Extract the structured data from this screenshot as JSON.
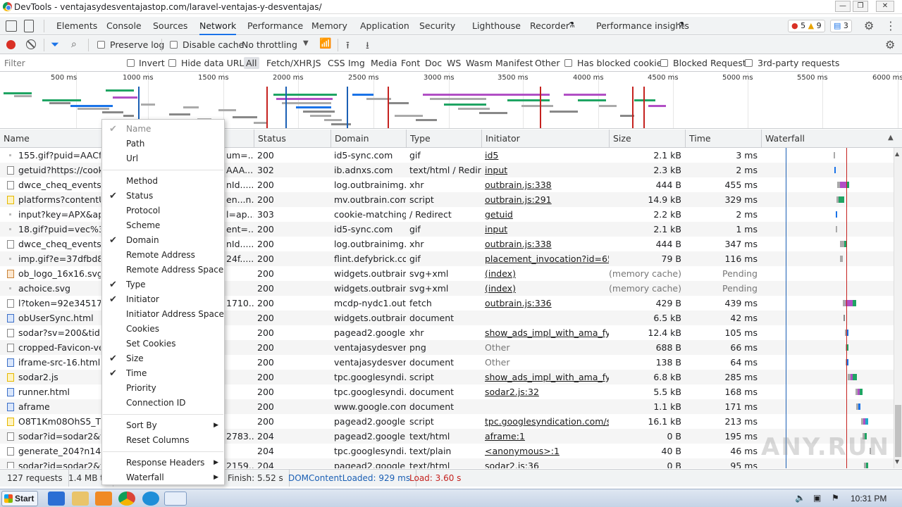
{
  "window": {
    "title": "DevTools - ventajasydesventajastop.com/laravel-ventajas-y-desventajas/",
    "minimize": "—",
    "restore": "❐",
    "close": "✕"
  },
  "tabs": [
    "Elements",
    "Console",
    "Sources",
    "Network",
    "Performance",
    "Memory",
    "Application",
    "Security",
    "Lighthouse",
    "Recorder",
    "Performance insights"
  ],
  "active_tab": "Network",
  "badges": {
    "errors": "5",
    "warnings": "9",
    "messages": "3"
  },
  "toolbar": {
    "preserve_log": "Preserve log",
    "disable_cache": "Disable cache",
    "throttling": "No throttling"
  },
  "filterbar": {
    "filter_placeholder": "Filter",
    "invert": "Invert",
    "hide_data_urls": "Hide data URLs",
    "types": [
      "All",
      "Fetch/XHR",
      "JS",
      "CSS",
      "Img",
      "Media",
      "Font",
      "Doc",
      "WS",
      "Wasm",
      "Manifest",
      "Other"
    ],
    "has_blocked_cookies": "Has blocked cookies",
    "blocked_requests": "Blocked Requests",
    "third_party": "3rd-party requests"
  },
  "overview": {
    "ticks": [
      "500 ms",
      "1000 ms",
      "1500 ms",
      "2000 ms",
      "2500 ms",
      "3000 ms",
      "3500 ms",
      "4000 ms",
      "4500 ms",
      "5000 ms",
      "5500 ms",
      "6000 ms"
    ]
  },
  "columns": {
    "name": "Name",
    "status": "Status",
    "domain": "Domain",
    "type": "Type",
    "initiator": "Initiator",
    "size": "Size",
    "time": "Time",
    "waterfall": "Waterfall"
  },
  "rows": [
    {
      "name": "155.gif?puid=AACfrk/",
      "mid": "um=...",
      "status": "200",
      "domain": "id5-sync.com",
      "type": "gif",
      "initiator": "id5",
      "init_link": true,
      "size": "2.1 kB",
      "time": "3 ms",
      "icon": "dot",
      "w": [
        {
          "l": 103,
          "w": 2,
          "c": "#aaa"
        }
      ]
    },
    {
      "name": "getuid?https://cookie-",
      "mid": "AAA...",
      "status": "302",
      "domain": "ib.adnxs.com",
      "type": "text/html / Redir...",
      "initiator": "input",
      "init_link": true,
      "size": "2.3 kB",
      "time": "2 ms",
      "icon": "plain",
      "w": [
        {
          "l": 104,
          "w": 2,
          "c": "#1a73e8"
        }
      ]
    },
    {
      "name": "dwce_cheq_events?tim",
      "mid": "nId......",
      "status": "200",
      "domain": "log.outbrainimg....",
      "type": "xhr",
      "initiator": "outbrain.js:338",
      "init_link": true,
      "size": "444 B",
      "time": "455 ms",
      "icon": "plain",
      "w": [
        {
          "l": 108,
          "w": 4,
          "c": "#aaa"
        },
        {
          "l": 112,
          "w": 9,
          "c": "#b14fc5"
        },
        {
          "l": 121,
          "w": 4,
          "c": "#1fa463"
        }
      ]
    },
    {
      "name": "platforms?contentUrl=",
      "mid": "en...n...",
      "status": "200",
      "domain": "mv.outbrain.com",
      "type": "script",
      "initiator": "outbrain.js:291",
      "init_link": true,
      "size": "14.9 kB",
      "time": "329 ms",
      "icon": "script",
      "w": [
        {
          "l": 107,
          "w": 3,
          "c": "#aaa"
        },
        {
          "l": 110,
          "w": 8,
          "c": "#1fa463"
        }
      ]
    },
    {
      "name": "input?key=APX&apx_u",
      "mid": "l=ap...",
      "status": "303",
      "domain": "cookie-matching....",
      "type": "/ Redirect",
      "initiator": "getuid",
      "init_link": true,
      "size": "2.2 kB",
      "time": "2 ms",
      "icon": "dot",
      "w": [
        {
          "l": 106,
          "w": 2,
          "c": "#1a73e8"
        }
      ]
    },
    {
      "name": "18.gif?puid=vec%3A80",
      "mid": "ent=...",
      "status": "200",
      "domain": "id5-sync.com",
      "type": "gif",
      "initiator": "input",
      "init_link": true,
      "size": "2.1 kB",
      "time": "1 ms",
      "icon": "dot",
      "w": [
        {
          "l": 106,
          "w": 2,
          "c": "#aaa"
        }
      ]
    },
    {
      "name": "dwce_cheq_events?tim",
      "mid": "nId......",
      "status": "200",
      "domain": "log.outbrainimg....",
      "type": "xhr",
      "initiator": "outbrain.js:338",
      "init_link": true,
      "size": "444 B",
      "time": "347 ms",
      "icon": "plain",
      "w": [
        {
          "l": 112,
          "w": 6,
          "c": "#aaa"
        },
        {
          "l": 118,
          "w": 4,
          "c": "#1fa463"
        }
      ]
    },
    {
      "name": "imp.gif?e=37dfbd8ee8",
      "mid": "24f......",
      "status": "200",
      "domain": "flint.defybrick.com",
      "type": "gif",
      "initiator": "placement_invocation?id=653...",
      "init_link": true,
      "size": "79 B",
      "time": "116 ms",
      "icon": "dot",
      "w": [
        {
          "l": 112,
          "w": 4,
          "c": "#aaa"
        }
      ]
    },
    {
      "name": "ob_logo_16x16.svg",
      "mid": "",
      "status": "200",
      "domain": "widgets.outbrain....",
      "type": "svg+xml",
      "initiator": "(index)",
      "init_link": true,
      "size": "(memory cache)",
      "size_gray": true,
      "time": "Pending",
      "time_gray": true,
      "icon": "img",
      "w": []
    },
    {
      "name": "achoice.svg",
      "mid": "",
      "status": "200",
      "domain": "widgets.outbrain....",
      "type": "svg+xml",
      "initiator": "(index)",
      "init_link": true,
      "size": "(memory cache)",
      "size_gray": true,
      "time": "Pending",
      "time_gray": true,
      "icon": "dot",
      "w": []
    },
    {
      "name": "l?token=92e345175e4",
      "mid": "1710...",
      "status": "200",
      "domain": "mcdp-nydc1.out...",
      "type": "fetch",
      "initiator": "outbrain.js:336",
      "init_link": true,
      "size": "429 B",
      "time": "439 ms",
      "icon": "plain",
      "w": [
        {
          "l": 116,
          "w": 4,
          "c": "#aaa"
        },
        {
          "l": 120,
          "w": 10,
          "c": "#b14fc5"
        },
        {
          "l": 130,
          "w": 5,
          "c": "#1fa463"
        }
      ]
    },
    {
      "name": "obUserSync.html",
      "mid": "",
      "status": "200",
      "domain": "widgets.outbrain....",
      "type": "document",
      "initiator": "",
      "init_link": false,
      "size": "6.5 kB",
      "time": "42 ms",
      "icon": "doc",
      "w": [
        {
          "l": 117,
          "w": 2,
          "c": "#888"
        }
      ]
    },
    {
      "name": "sodar?sv=200&tid=go",
      "mid": "",
      "status": "200",
      "domain": "pagead2.google...",
      "type": "xhr",
      "initiator": "show_ads_impl_with_ama_fy20...",
      "init_link": true,
      "size": "12.4 kB",
      "time": "105 ms",
      "icon": "plain",
      "w": [
        {
          "l": 119,
          "w": 2,
          "c": "#aaa"
        },
        {
          "l": 121,
          "w": 3,
          "c": "#1a73e8"
        }
      ]
    },
    {
      "name": "cropped-Favicon-vent",
      "mid": "",
      "status": "200",
      "domain": "ventajasydesven...",
      "type": "png",
      "initiator": "Other",
      "init_link": false,
      "init_gray": true,
      "size": "688 B",
      "time": "66 ms",
      "icon": "plain",
      "w": [
        {
          "l": 120,
          "w": 2,
          "c": "#aaa"
        },
        {
          "l": 122,
          "w": 2,
          "c": "#1fa463"
        }
      ]
    },
    {
      "name": "iframe-src-16.html",
      "mid": "",
      "status": "200",
      "domain": "ventajasydesven...",
      "type": "document",
      "initiator": "Other",
      "init_link": false,
      "init_gray": true,
      "size": "138 B",
      "time": "64 ms",
      "icon": "doc",
      "w": [
        {
          "l": 120,
          "w": 2,
          "c": "#aaa"
        },
        {
          "l": 122,
          "w": 2,
          "c": "#1a73e8"
        }
      ]
    },
    {
      "name": "sodar2.js",
      "mid": "",
      "status": "200",
      "domain": "tpc.googlesyndi...",
      "type": "script",
      "initiator": "show_ads_impl_with_ama_fy20...",
      "init_link": true,
      "size": "6.8 kB",
      "time": "285 ms",
      "icon": "script",
      "w": [
        {
          "l": 123,
          "w": 4,
          "c": "#aaa"
        },
        {
          "l": 127,
          "w": 3,
          "c": "#b14fc5"
        },
        {
          "l": 130,
          "w": 6,
          "c": "#1fa463"
        }
      ]
    },
    {
      "name": "runner.html",
      "mid": "",
      "status": "200",
      "domain": "tpc.googlesyndi...",
      "type": "document",
      "initiator": "sodar2.js:32",
      "init_link": true,
      "size": "5.5 kB",
      "time": "168 ms",
      "icon": "doc",
      "w": [
        {
          "l": 134,
          "w": 3,
          "c": "#aaa"
        },
        {
          "l": 137,
          "w": 3,
          "c": "#b14fc5"
        },
        {
          "l": 140,
          "w": 4,
          "c": "#1fa463"
        }
      ]
    },
    {
      "name": "aframe",
      "mid": "",
      "status": "200",
      "domain": "www.google.com",
      "type": "document",
      "initiator": "",
      "init_link": false,
      "size": "1.1 kB",
      "time": "171 ms",
      "icon": "doc",
      "w": [
        {
          "l": 135,
          "w": 3,
          "c": "#aaa"
        },
        {
          "l": 138,
          "w": 3,
          "c": "#1a73e8"
        }
      ]
    },
    {
      "name": "O8T1Km08OhS5_Tz58j",
      "mid": "",
      "status": "200",
      "domain": "pagead2.google...",
      "type": "script",
      "initiator": "tpc.googlesyndication.com/so...",
      "init_link": true,
      "size": "16.1 kB",
      "time": "213 ms",
      "icon": "script",
      "w": [
        {
          "l": 142,
          "w": 3,
          "c": "#aaa"
        },
        {
          "l": 145,
          "w": 3,
          "c": "#b14fc5"
        },
        {
          "l": 148,
          "w": 4,
          "c": "#1fa8c8"
        }
      ]
    },
    {
      "name": "sodar?id=sodar2&v=2",
      "mid": "2783...",
      "status": "204",
      "domain": "pagead2.google...",
      "type": "text/html",
      "initiator": "aframe:1",
      "init_link": true,
      "size": "0 B",
      "time": "195 ms",
      "icon": "plain",
      "w": [
        {
          "l": 144,
          "w": 3,
          "c": "#aaa"
        },
        {
          "l": 147,
          "w": 3,
          "c": "#1fa463"
        }
      ]
    },
    {
      "name": "generate_204?n14SeA",
      "mid": "",
      "status": "204",
      "domain": "tpc.googlesyndi...",
      "type": "text/plain",
      "initiator": "<anonymous>:1",
      "init_link": true,
      "size": "40 B",
      "time": "46 ms",
      "icon": "plain",
      "w": [
        {
          "l": 154,
          "w": 2,
          "c": "#aaa"
        }
      ]
    },
    {
      "name": "sodar?id=sodar2&v=2",
      "mid": "2159...",
      "status": "204",
      "domain": "pagead2.google...",
      "type": "text/html",
      "initiator": "sodar2.js:36",
      "init_link": true,
      "size": "0 B",
      "time": "95 ms",
      "icon": "plain",
      "w": [
        {
          "l": 146,
          "w": 3,
          "c": "#aaa"
        },
        {
          "l": 149,
          "w": 3,
          "c": "#1fa463"
        }
      ]
    }
  ],
  "context_menu": {
    "group1": [
      {
        "label": "Name",
        "checked": true,
        "disabled": true
      },
      {
        "label": "Path",
        "checked": false
      },
      {
        "label": "Url",
        "checked": false
      }
    ],
    "group2": [
      {
        "label": "Method",
        "checked": false
      },
      {
        "label": "Status",
        "checked": true
      },
      {
        "label": "Protocol",
        "checked": false
      },
      {
        "label": "Scheme",
        "checked": false
      },
      {
        "label": "Domain",
        "checked": true
      },
      {
        "label": "Remote Address",
        "checked": false
      },
      {
        "label": "Remote Address Space",
        "checked": false
      },
      {
        "label": "Type",
        "checked": true
      },
      {
        "label": "Initiator",
        "checked": true
      },
      {
        "label": "Initiator Address Space",
        "checked": false
      },
      {
        "label": "Cookies",
        "checked": false
      },
      {
        "label": "Set Cookies",
        "checked": false
      },
      {
        "label": "Size",
        "checked": true
      },
      {
        "label": "Time",
        "checked": true
      },
      {
        "label": "Priority",
        "checked": false
      },
      {
        "label": "Connection ID",
        "checked": false
      }
    ],
    "group3": [
      {
        "label": "Sort By",
        "submenu": true
      },
      {
        "label": "Reset Columns",
        "submenu": false
      }
    ],
    "group4": [
      {
        "label": "Response Headers",
        "submenu": true
      },
      {
        "label": "Waterfall",
        "submenu": true
      }
    ]
  },
  "status": {
    "requests": "127 requests",
    "transferred": "1.4 MB tr",
    "finish": "Finish: 5.52 s",
    "dcl": "DOMContentLoaded: 929 ms",
    "load": "Load: 3.60 s"
  },
  "watermark": "ANY.RUN",
  "taskbar": {
    "start": "Start",
    "clock": "10:31 PM"
  },
  "colors": {
    "accent": "#1a73e8",
    "dcl": "#1a5fb4",
    "load": "#c5221f",
    "green": "#1fa463",
    "purple": "#b14fc5"
  }
}
